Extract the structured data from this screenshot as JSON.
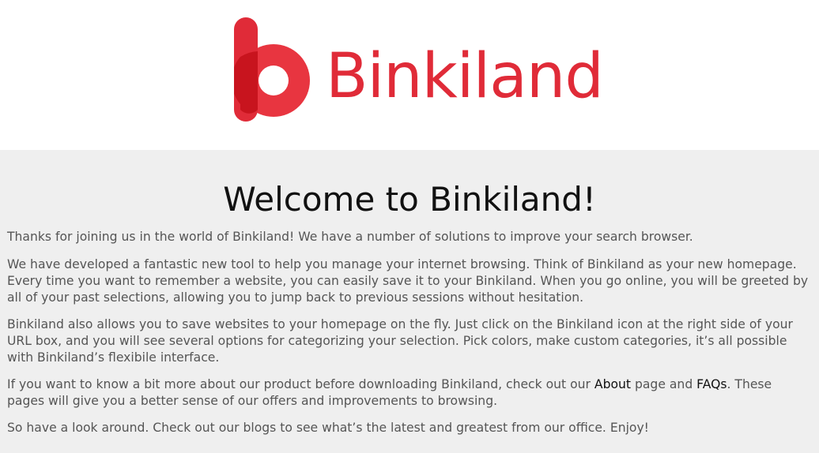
{
  "header": {
    "brand_name": "Binkiland",
    "logo_icon": "binkiland-b-logo-icon",
    "brand_color": "#e02b38"
  },
  "main": {
    "title": "Welcome to Binkiland!",
    "paragraph_1": "Thanks for joining us in the world of Binkiland! We have a number of solutions to improve your search browser.",
    "paragraph_2": "We have developed a fantastic new tool to help you manage your internet browsing. Think of Binkiland as your new homepage. Every time you want to remember a website, you can easily save it to your Binkiland. When you go online, you will be greeted by all of your past selections, allowing you to jump back to previous sessions without hesitation.",
    "paragraph_3": "Binkiland also allows you to save websites to your homepage on the fly. Just click on the Binkiland icon at the right side of your URL box, and you will see several options for categorizing your selection. Pick colors, make custom categories, it’s all possible with Binkiland’s flexibile interface.",
    "paragraph_4": {
      "part_1": "If you want to know a bit more about our product before downloading Binkiland, check out our ",
      "about_link": "About",
      "part_2": " page and ",
      "faqs_link": "FAQs",
      "part_3": ". These pages will give you a better sense of our offers and improvements to browsing."
    },
    "paragraph_5": "So have a look around. Check out our blogs to see what’s the latest and greatest from our office. Enjoy!"
  },
  "colors": {
    "header_background": "#ffffff",
    "content_background": "#efefef",
    "body_text": "#555555",
    "title_text": "#111111",
    "link_text": "#111111"
  }
}
